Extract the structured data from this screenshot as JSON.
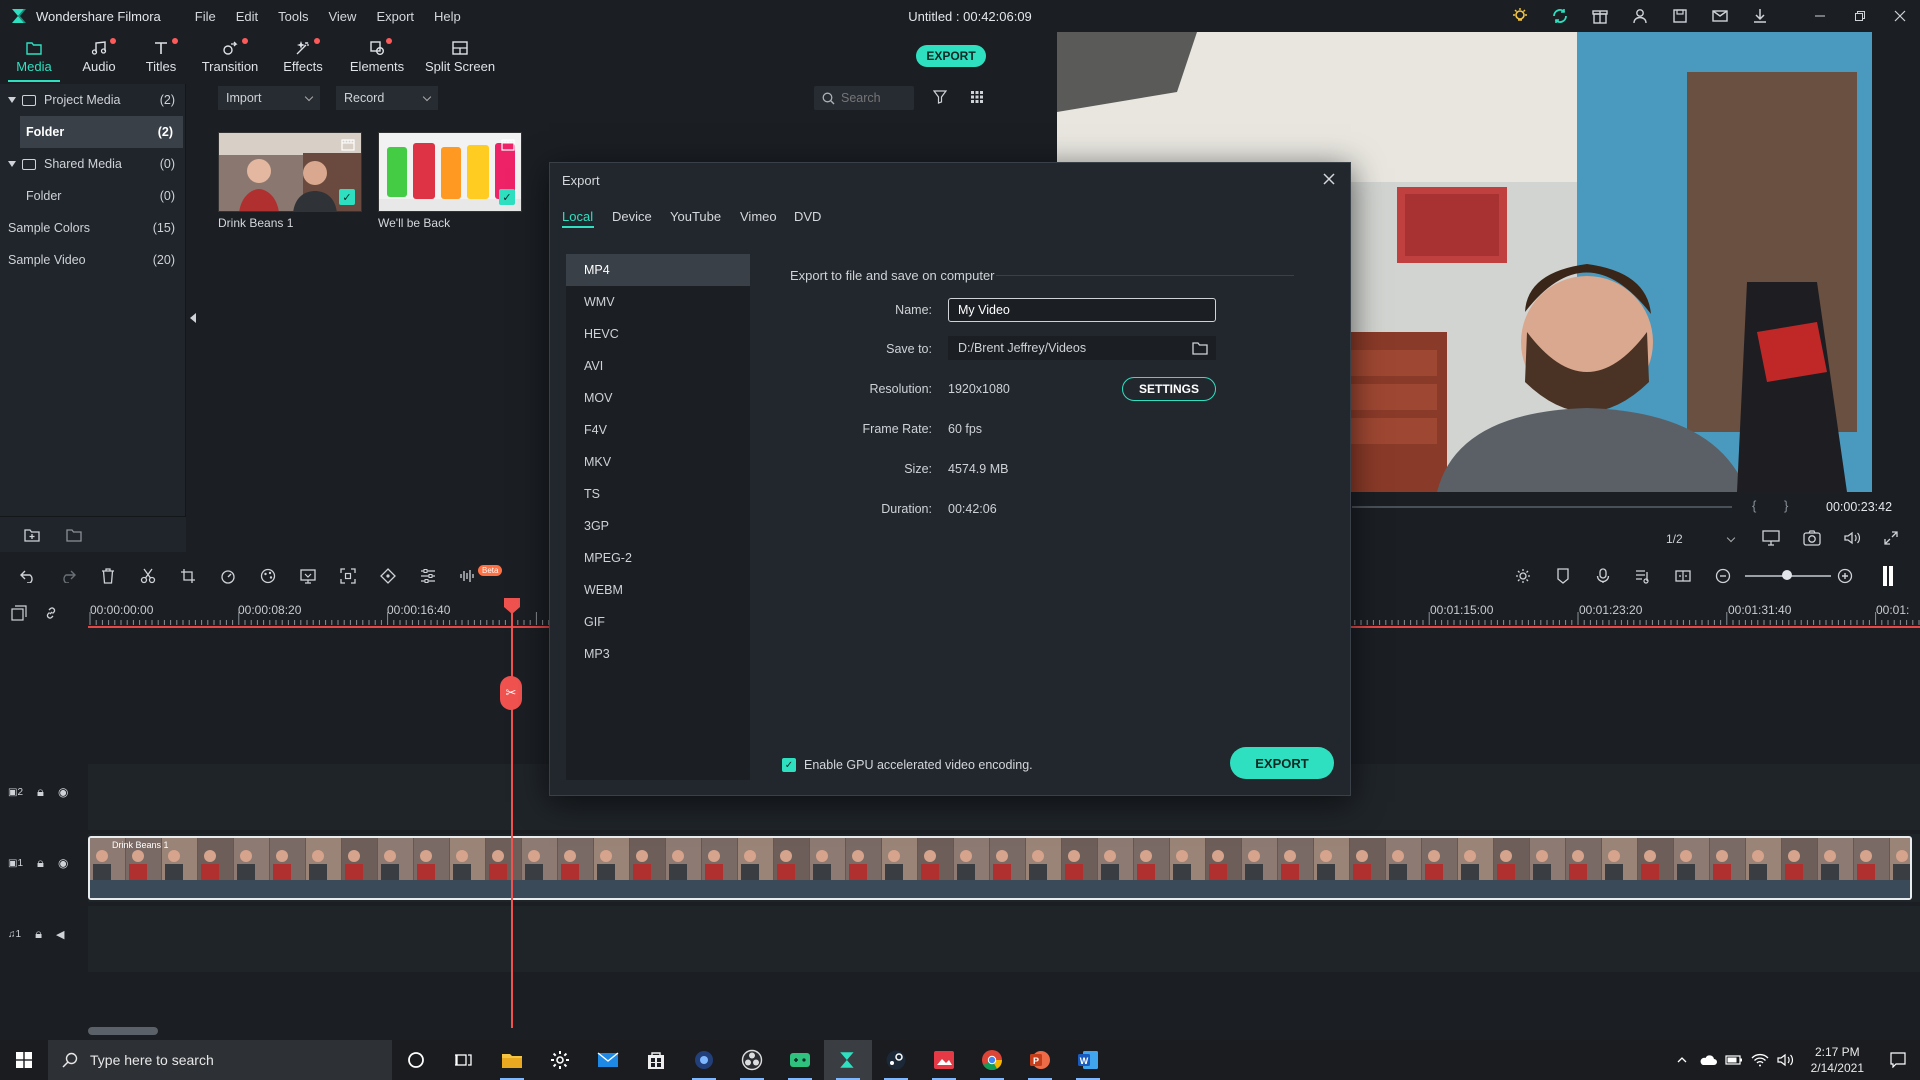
{
  "app": {
    "name": "Wondershare Filmora",
    "window_title": "Untitled : 00:42:06:09",
    "menu": [
      "File",
      "Edit",
      "Tools",
      "View",
      "Export",
      "Help"
    ]
  },
  "toolbar": {
    "tabs": [
      {
        "label": "Media",
        "icon": "media-icon",
        "active": true,
        "dot": false
      },
      {
        "label": "Audio",
        "icon": "audio-icon",
        "active": false,
        "dot": true
      },
      {
        "label": "Titles",
        "icon": "titles-icon",
        "active": false,
        "dot": true
      },
      {
        "label": "Transition",
        "icon": "transition-icon",
        "active": false,
        "dot": true
      },
      {
        "label": "Effects",
        "icon": "effects-icon",
        "active": false,
        "dot": true
      },
      {
        "label": "Elements",
        "icon": "elements-icon",
        "active": false,
        "dot": true
      },
      {
        "label": "Split Screen",
        "icon": "split-screen-icon",
        "active": false,
        "dot": false
      }
    ],
    "export_label": "EXPORT"
  },
  "media_tree": {
    "items": [
      {
        "label": "Project Media",
        "count": "(2)"
      },
      {
        "label": "Folder",
        "count": "(2)"
      },
      {
        "label": "Shared Media",
        "count": "(0)"
      },
      {
        "label": "Folder",
        "count": "(0)"
      },
      {
        "label": "Sample Colors",
        "count": "(15)"
      },
      {
        "label": "Sample Video",
        "count": "(20)"
      }
    ]
  },
  "media_bar": {
    "import_label": "Import",
    "record_label": "Record",
    "search_placeholder": "Search"
  },
  "media_items": [
    {
      "label": "Drink Beans 1"
    },
    {
      "label": "We'll be Back"
    }
  ],
  "preview": {
    "time": "00:00:23:42",
    "ratio": "1/2"
  },
  "timeline": {
    "ticks": [
      "00:00:00:00",
      "00:00:08:20",
      "00:00:16:40",
      "00:01:15:00",
      "00:01:23:20",
      "00:01:31:40",
      "00:01:"
    ],
    "clip_name": "Drink Beans 1",
    "beta": "Beta"
  },
  "export_dialog": {
    "title": "Export",
    "tabs": [
      "Local",
      "Device",
      "YouTube",
      "Vimeo",
      "DVD"
    ],
    "formats": [
      "MP4",
      "WMV",
      "HEVC",
      "AVI",
      "MOV",
      "F4V",
      "MKV",
      "TS",
      "3GP",
      "MPEG-2",
      "WEBM",
      "GIF",
      "MP3"
    ],
    "section_title": "Export to file and save on computer",
    "name_label": "Name:",
    "name_value": "My Video",
    "save_label": "Save to:",
    "save_value": "D:/Brent Jeffrey/Videos",
    "resolution_label": "Resolution:",
    "resolution_value": "1920x1080",
    "settings_label": "SETTINGS",
    "framerate_label": "Frame Rate:",
    "framerate_value": "60 fps",
    "size_label": "Size:",
    "size_value": "4574.9 MB",
    "duration_label": "Duration:",
    "duration_value": "00:42:06",
    "gpu_label": "Enable GPU accelerated video encoding.",
    "export_label": "EXPORT"
  },
  "taskbar": {
    "search_text": "Type here to search",
    "time": "2:17 PM",
    "date": "2/14/2021"
  },
  "colors": {
    "accent": "#2ee0c0",
    "playhead": "#f0524f",
    "panel": "#22272d"
  }
}
